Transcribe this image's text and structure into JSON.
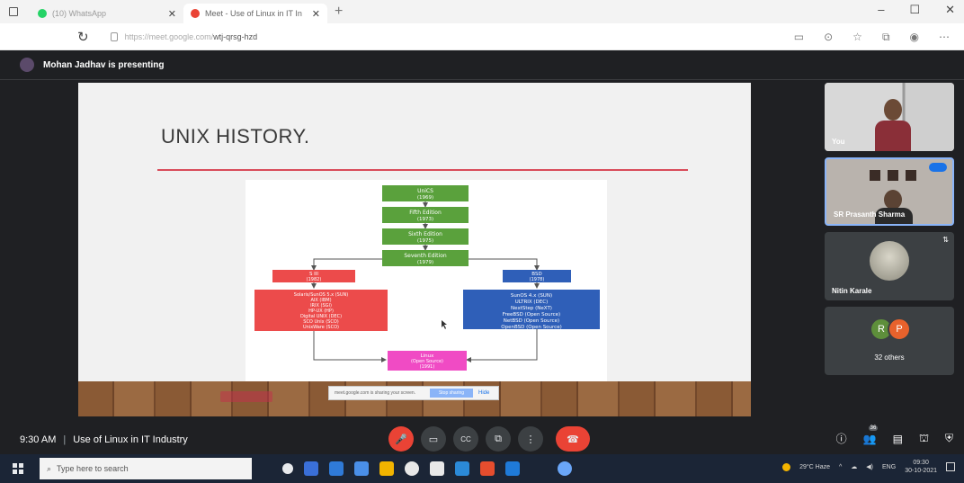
{
  "browser": {
    "tabs": [
      {
        "title": "(10) WhatsApp",
        "active": false,
        "favicon_color": "#25d366"
      },
      {
        "title": "Meet - Use of Linux in IT In",
        "active": true,
        "favicon_color": "#ea4335"
      }
    ],
    "new_tab": "+",
    "url_host": "https://meet.google.com/",
    "url_path": "wtj-qrsg-hzd",
    "window_controls": [
      "–",
      "☐",
      "✕"
    ]
  },
  "meet": {
    "presenter_banner": "Mohan Jadhav is presenting",
    "slide": {
      "title": "UNIX HISTORY.",
      "share_bar": {
        "text": "meet.google.com is sharing your screen.",
        "stop_label": "Stop sharing",
        "hide_label": "Hide"
      }
    },
    "diagram": {
      "top_nodes": [
        {
          "label": "UniCS",
          "sub": "(1969)"
        },
        {
          "label": "Fifth Edition",
          "sub": "(1973)"
        },
        {
          "label": "Sixth Edition",
          "sub": "(1975)"
        },
        {
          "label": "Seventh Edition",
          "sub": "(1979)"
        }
      ],
      "left_header": {
        "label": "S III",
        "sub": "(1982)"
      },
      "left_body": [
        "Solaris/SunOS 5.x (SUN)",
        "AIX (IBM)",
        "IRIX (SGI)",
        "HP-UX (HP)",
        "Digital UNIX (DEC)",
        "SCO Unix (SCO)",
        "UnixWare (SCO)"
      ],
      "right_header": {
        "label": "BSD",
        "sub": "(1978)"
      },
      "right_body": [
        "SunOS 4.x (SUN)",
        "ULTRIX (DEC)",
        "NextStep (NeXT)",
        "FreeBSD (Open Source)",
        "NetBSD (Open Source)",
        "OpenBSD (Open Source)"
      ],
      "bottom_node": {
        "label": "Linux",
        "sub": "(Open Source)",
        "sub2": "(1991)"
      },
      "colors": {
        "green": "#5aa13c",
        "red": "#ec4b4b",
        "blue": "#2f5fb8",
        "pink": "#f04bc4"
      }
    },
    "participants": [
      {
        "name": "You"
      },
      {
        "name": "SR Prasanth Sharma"
      },
      {
        "name": "Nitin Karale"
      },
      {
        "avatars": [
          "R",
          "P"
        ],
        "label": "32 others"
      }
    ],
    "bottom_bar": {
      "time": "9:30 AM",
      "separator": "|",
      "meeting_title": "Use of Linux in IT Industry",
      "controls": [
        {
          "icon": "mic-off-icon",
          "glyph": "🎤"
        },
        {
          "icon": "camera-icon",
          "glyph": "▭"
        },
        {
          "icon": "captions-icon",
          "glyph": "CC"
        },
        {
          "icon": "present-icon",
          "glyph": "⧉"
        },
        {
          "icon": "more-options-icon",
          "glyph": "⋮"
        },
        {
          "icon": "hang-up-icon",
          "glyph": "☎"
        }
      ],
      "people_count": "36",
      "right_icons": [
        {
          "icon": "info-icon",
          "glyph": "ⓘ"
        },
        {
          "icon": "people-icon",
          "glyph": "👥"
        },
        {
          "icon": "chat-icon",
          "glyph": "▤"
        },
        {
          "icon": "activities-icon",
          "glyph": "⛫"
        },
        {
          "icon": "shield-icon",
          "glyph": "⛨"
        }
      ]
    }
  },
  "taskbar": {
    "search_placeholder": "Type here to search",
    "pinned_colors": [
      "#e8eaed",
      "#3a6fd8",
      "#f2b400",
      "#e8eaed",
      "#2b8ad8",
      "#e8e8e8",
      "#6aa6f8",
      "#e54d2e",
      "#1f7ad8",
      "#2b8ad8"
    ],
    "weather": "29°C Haze",
    "lang": "ENG",
    "time": "09:30",
    "date": "30-10-2021"
  }
}
